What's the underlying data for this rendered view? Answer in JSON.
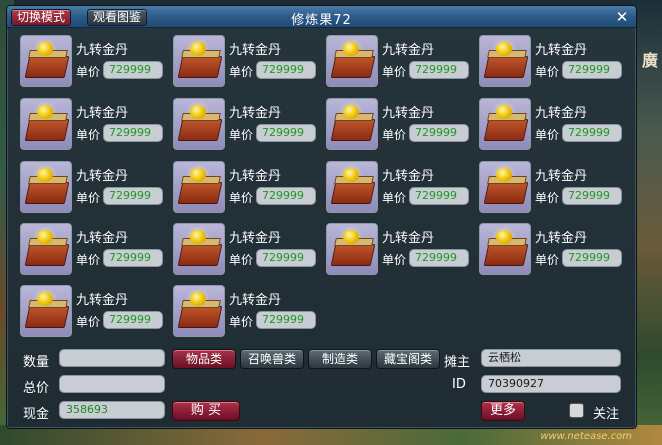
{
  "window": {
    "title": "修炼果72",
    "mode_button": "切换模式",
    "gallery_button": "观看图鉴",
    "close_glyph": "✕"
  },
  "items": [
    {
      "name": "九转金丹",
      "price_label": "单价",
      "price": "729999"
    },
    {
      "name": "九转金丹",
      "price_label": "单价",
      "price": "729999"
    },
    {
      "name": "九转金丹",
      "price_label": "单价",
      "price": "729999"
    },
    {
      "name": "九转金丹",
      "price_label": "单价",
      "price": "729999"
    },
    {
      "name": "九转金丹",
      "price_label": "单价",
      "price": "729999"
    },
    {
      "name": "九转金丹",
      "price_label": "单价",
      "price": "729999"
    },
    {
      "name": "九转金丹",
      "price_label": "单价",
      "price": "729999"
    },
    {
      "name": "九转金丹",
      "price_label": "单价",
      "price": "729999"
    },
    {
      "name": "九转金丹",
      "price_label": "单价",
      "price": "729999"
    },
    {
      "name": "九转金丹",
      "price_label": "单价",
      "price": "729999"
    },
    {
      "name": "九转金丹",
      "price_label": "单价",
      "price": "729999"
    },
    {
      "name": "九转金丹",
      "price_label": "单价",
      "price": "729999"
    },
    {
      "name": "九转金丹",
      "price_label": "单价",
      "price": "729999"
    },
    {
      "name": "九转金丹",
      "price_label": "单价",
      "price": "729999"
    },
    {
      "name": "九转金丹",
      "price_label": "单价",
      "price": "729999"
    },
    {
      "name": "九转金丹",
      "price_label": "单价",
      "price": "729999"
    },
    {
      "name": "九转金丹",
      "price_label": "单价",
      "price": "729999"
    },
    {
      "name": "九转金丹",
      "price_label": "单价",
      "price": "729999"
    }
  ],
  "form": {
    "quantity_label": "数量",
    "quantity_value": "",
    "total_label": "总价",
    "total_value": "",
    "cash_label": "现金",
    "cash_value": "358693",
    "buy_button": "购 买"
  },
  "categories": {
    "items": "物品类",
    "summon": "召唤兽类",
    "crafting": "制造类",
    "treasure": "藏宝阁类"
  },
  "seller": {
    "owner_label": "摊主",
    "owner_value": "云栖松",
    "id_label": "ID",
    "id_value": "70390927",
    "more_button": "更多",
    "follow_label": "关注"
  },
  "background": {
    "right_sign": "廣",
    "watermark": "www.netease.com"
  },
  "colors": {
    "title_bar": "#2d5c88",
    "active_button": "#a8334a",
    "price_text": "#1e9a1e",
    "window_bg": "#26343c"
  }
}
